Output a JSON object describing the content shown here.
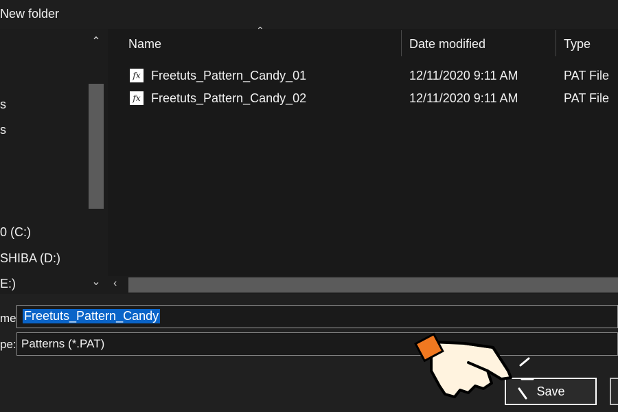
{
  "toolbar": {
    "new_folder": "New folder"
  },
  "nav": {
    "items": [
      {
        "label": "s"
      },
      {
        "label": "s"
      },
      {
        "label": "0 (C:)"
      },
      {
        "label": "SHIBA (D:)"
      },
      {
        "label": "E:)"
      }
    ]
  },
  "columns": {
    "name": "Name",
    "date": "Date modified",
    "type": "Type"
  },
  "files": [
    {
      "icon": "fx",
      "name": "Freetuts_Pattern_Candy_01",
      "date": "12/11/2020 9:11 AM",
      "type": "PAT File"
    },
    {
      "icon": "fx",
      "name": "Freetuts_Pattern_Candy_02",
      "date": "12/11/2020 9:11 AM",
      "type": "PAT File"
    }
  ],
  "form": {
    "name_label": "me:",
    "name_value": "Freetuts_Pattern_Candy",
    "type_label": "pe:",
    "type_value": "Patterns (*.PAT)"
  },
  "buttons": {
    "save": "Save"
  },
  "colors": {
    "selection": "#0a64c8",
    "background": "#202020",
    "hand_accent": "#f07820"
  }
}
